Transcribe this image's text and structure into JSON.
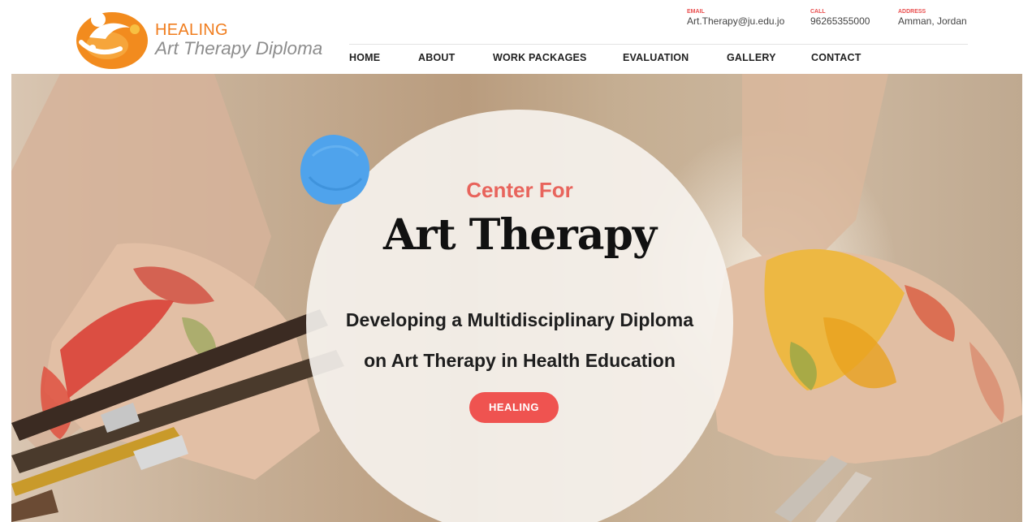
{
  "logo": {
    "line1": "HEALING",
    "line2": "Art Therapy Diploma"
  },
  "contact": {
    "email_label": "EMAIL",
    "email": "Art.Therapy@ju.edu.jo",
    "call_label": "CALL",
    "phone": "96265355000",
    "address_label": "ADDRESS",
    "address": "Amman, Jordan"
  },
  "nav": [
    "HOME",
    "ABOUT",
    "WORK PACKAGES",
    "EVALUATION",
    "GALLERY",
    "CONTACT"
  ],
  "hero": {
    "eyebrow": "Center For",
    "title": "Art Therapy",
    "subtitle_line1": "Developing a Multidisciplinary Diploma",
    "subtitle_line2": "on Art Therapy in Health Education",
    "cta": "HEALING"
  },
  "colors": {
    "accent": "#ef5350",
    "brand_orange": "#f07d1e",
    "blob_blue": "#4fa3ec"
  }
}
